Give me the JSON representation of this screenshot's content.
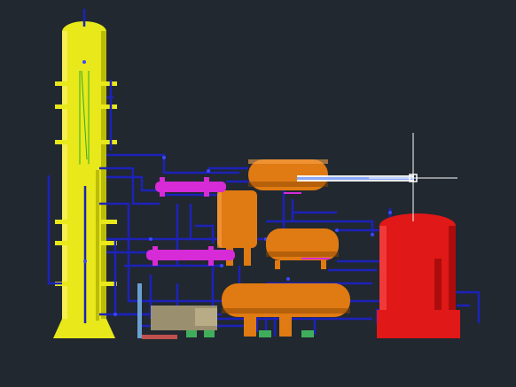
{
  "viewport": {
    "background": "#212830",
    "label": ""
  },
  "colors": {
    "column": "#e8e81a",
    "column_dark": "#9c9c00",
    "drum": "#e07a12",
    "drum_dark": "#8a4604",
    "tank": "#e01818",
    "tank_dark": "#7a0000",
    "exchanger": "#d62bd6",
    "piping": "#1c22b8",
    "pump": "#3fae5b",
    "highlight": "#ffffff",
    "base": "#9a9070"
  },
  "icons": {
    "crosshair": "crosshair-cursor-icon",
    "grip": "selection-grip-icon"
  }
}
